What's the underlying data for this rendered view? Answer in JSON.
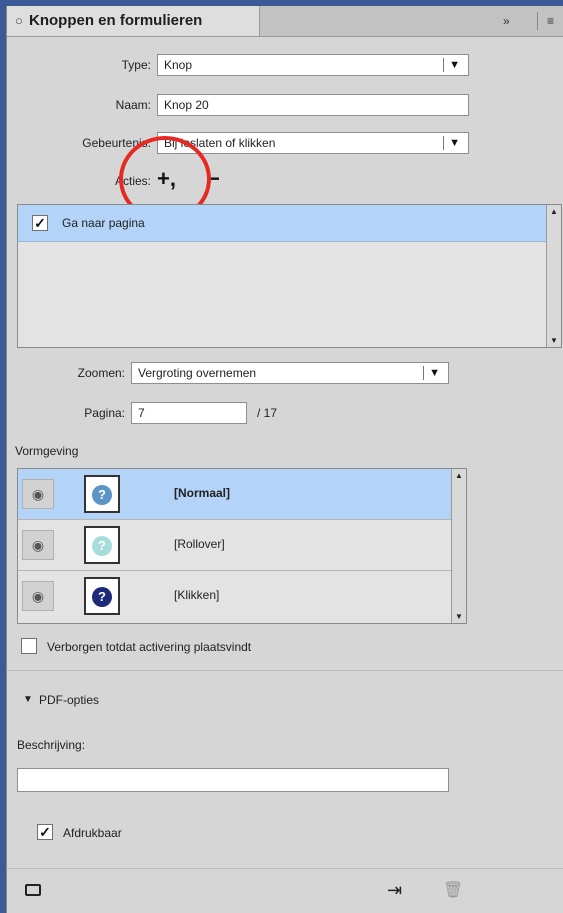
{
  "panel": {
    "title": "Knoppen en formulieren",
    "close_glyph": "○",
    "expand_glyph": "»",
    "menu_glyph": "≡"
  },
  "form": {
    "type_label": "Type:",
    "type_value": "Knop",
    "name_label": "Naam:",
    "name_value": "Knop 20",
    "event_label": "Gebeurtenis:",
    "event_value": "Bij loslaten of klikken",
    "actions_label": "Acties:",
    "add_action_glyph": "+,",
    "remove_action_glyph": "−"
  },
  "actions_list": [
    {
      "label": "Ga naar pagina",
      "checked": true,
      "selected": true
    }
  ],
  "zoom": {
    "label": "Zoomen:",
    "value": "Vergroting overnemen"
  },
  "page": {
    "label": "Pagina:",
    "value": "7",
    "total": "/ 17"
  },
  "appearance": {
    "heading": "Vormgeving",
    "states": [
      {
        "label": "[Normaal]",
        "bold": true,
        "selected": true,
        "icon_color": "#5b95c6",
        "glyph": "?"
      },
      {
        "label": "[Rollover]",
        "bold": false,
        "selected": false,
        "icon_color": "#a7dcdd",
        "glyph": "?"
      },
      {
        "label": "[Klikken]",
        "bold": false,
        "selected": false,
        "icon_color": "#1d2a7a",
        "glyph": "?"
      }
    ]
  },
  "hidden_until_triggered": {
    "label": "Verborgen totdat activering plaatsvindt",
    "checked": false
  },
  "pdf": {
    "section_label": "PDF-opties",
    "description_label": "Beschrijving:",
    "description_value": "",
    "printable_label": "Afdrukbaar",
    "printable_checked": true
  },
  "colors": {
    "selection": "#b4d3f8",
    "annotation_circle": "#e52a24",
    "desktop": "#3d5a98"
  }
}
